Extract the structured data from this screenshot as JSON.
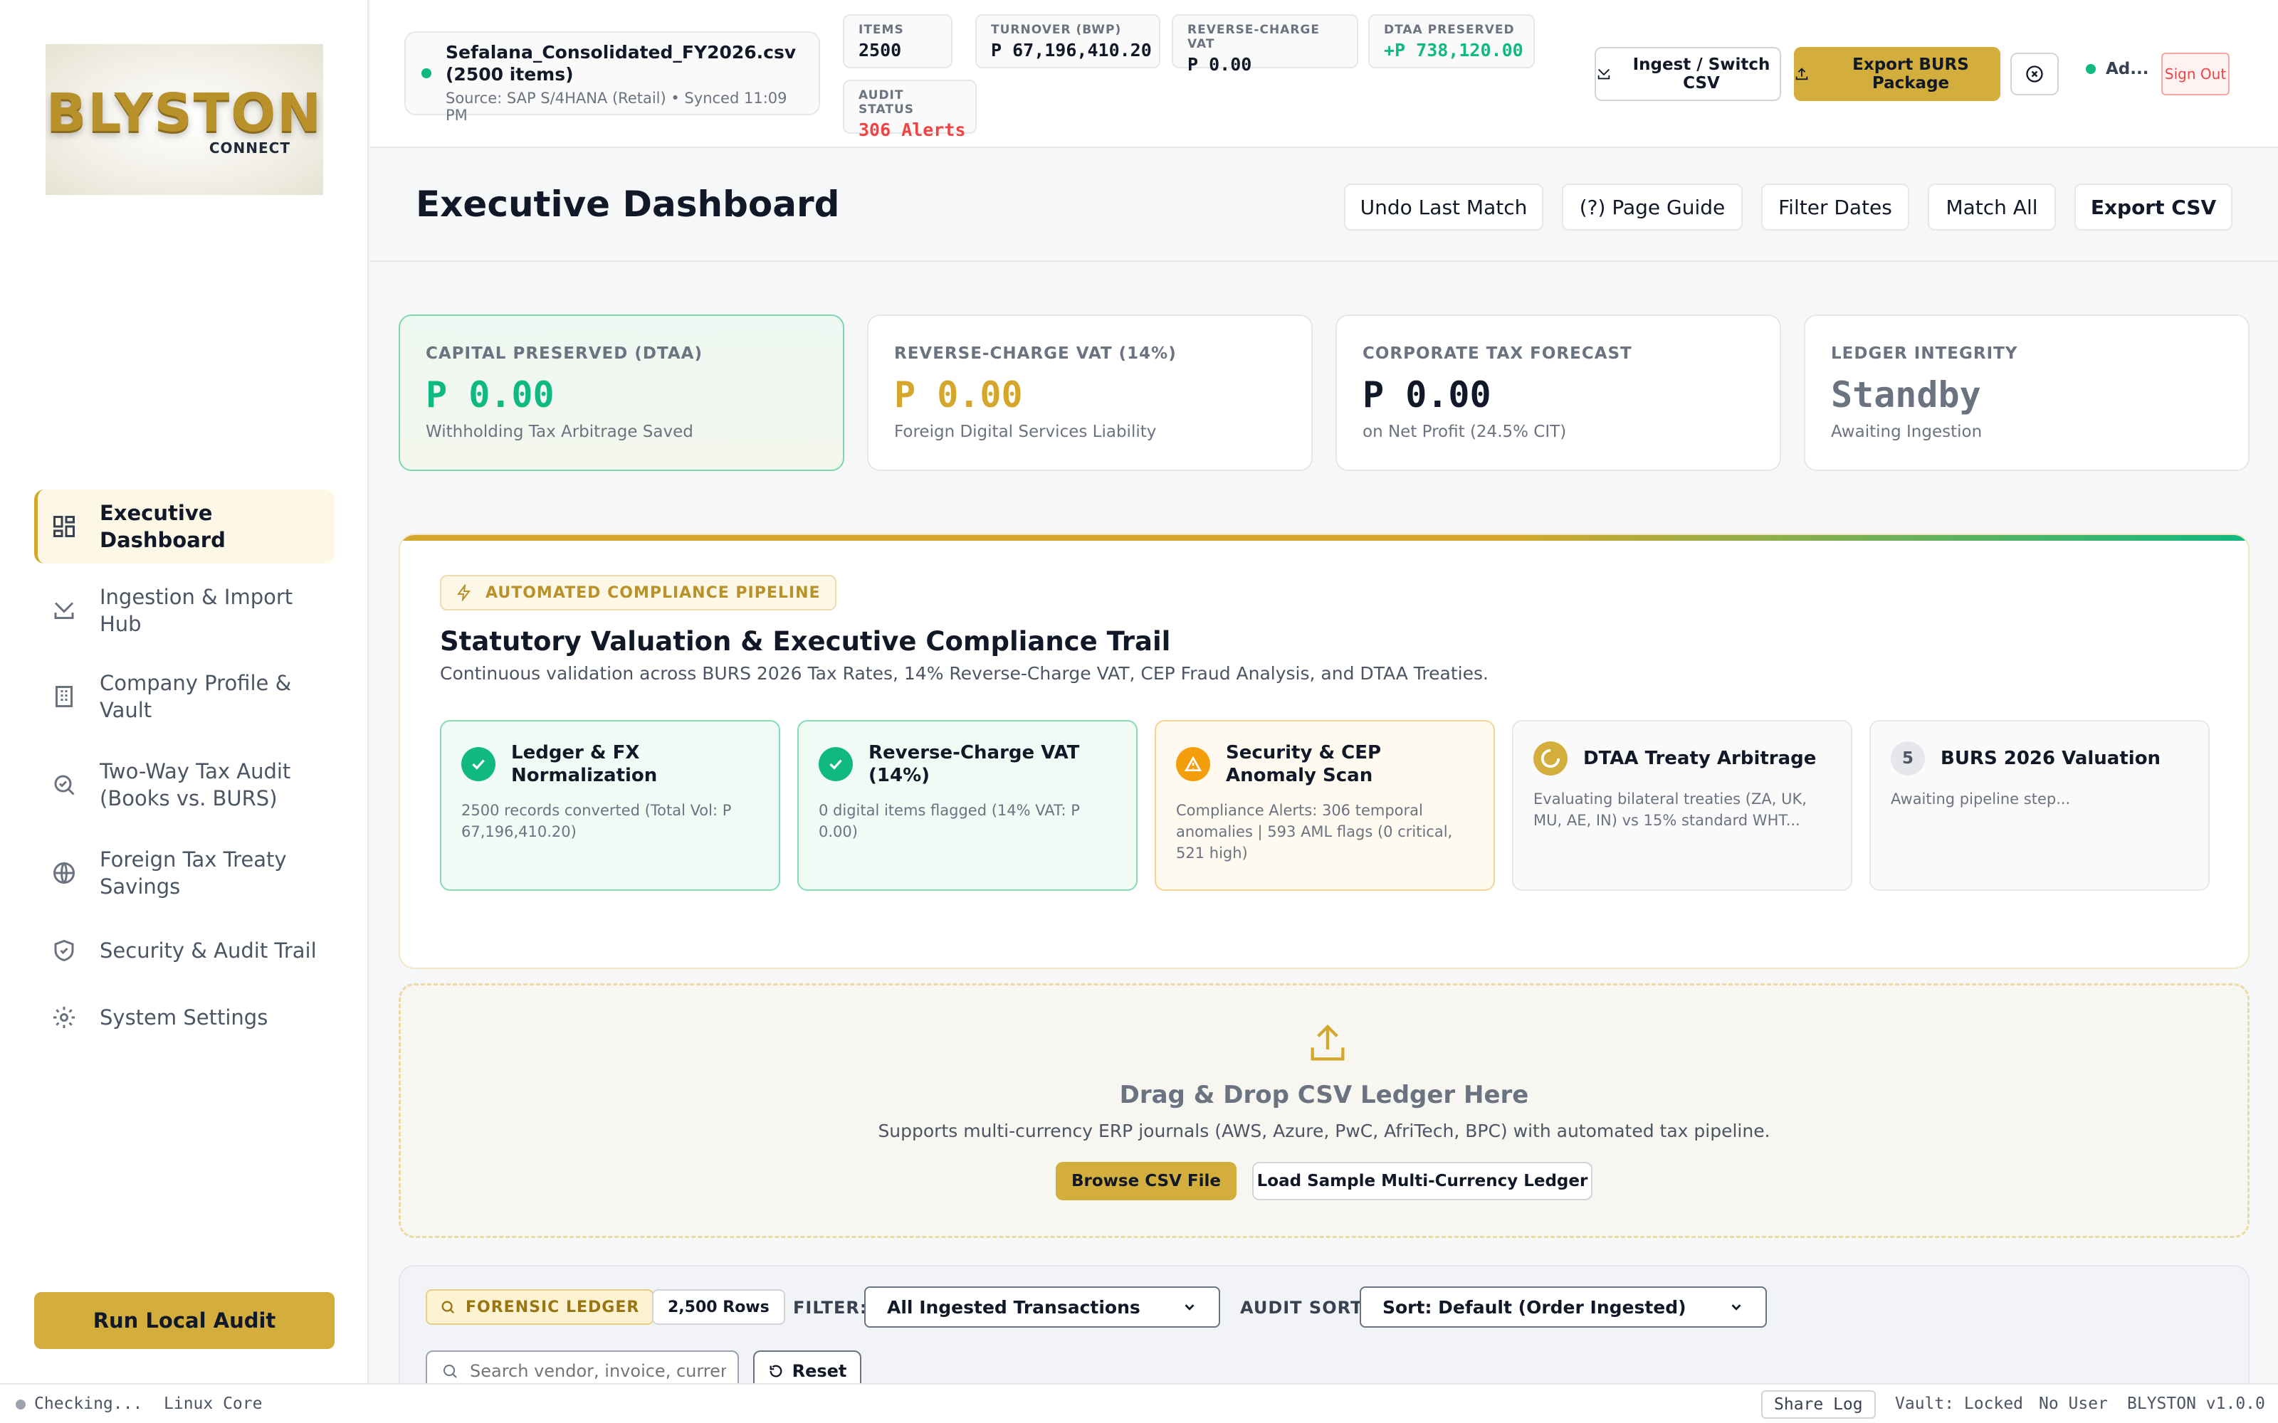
{
  "brand": {
    "logo_word": "BLYSTON",
    "logo_sub": "CONNECT"
  },
  "sidebar": {
    "items": [
      {
        "label": "Executive Dashboard",
        "icon": "dashboard-grid-icon",
        "active": true
      },
      {
        "label": "Ingestion & Import Hub",
        "icon": "tray-download-icon"
      },
      {
        "label": "Company Profile & Vault",
        "icon": "building-icon"
      },
      {
        "label": "Two-Way Tax Audit (Books vs. BURS)",
        "icon": "search-audit-icon"
      },
      {
        "label": "Foreign Tax Treaty Savings",
        "icon": "globe-icon"
      },
      {
        "label": "Security & Audit Trail",
        "icon": "shield-check-icon"
      },
      {
        "label": "System Settings",
        "icon": "gear-icon"
      }
    ],
    "run_audit_label": "Run Local Audit"
  },
  "topbar": {
    "file_name": "Sefalana_Consolidated_FY2026.csv (2500 items)",
    "file_source": "Source: SAP S/4HANA (Retail) • Synced 11:09 PM",
    "stats": {
      "items_label": "ITEMS",
      "items_value": "2500",
      "turnover_label": "TURNOVER (BWP)",
      "turnover_value": "P 67,196,410.20",
      "rcvat_label": "REVERSE-CHARGE VAT",
      "rcvat_value": "P 0.00",
      "dtaa_label": "DTAA PRESERVED",
      "dtaa_value": "+P 738,120.00",
      "audit_label": "AUDIT STATUS",
      "audit_value": "306 Alerts"
    },
    "ingest_label": "Ingest / Switch CSV",
    "export_label": "Export BURS Package",
    "admin_label": "Ad...",
    "signout_label": "Sign Out"
  },
  "page": {
    "title": "Executive Dashboard",
    "actions": {
      "undo": "Undo Last Match",
      "guide": "(?) Page Guide",
      "filter": "Filter Dates",
      "match_all": "Match All",
      "export_csv": "Export CSV"
    }
  },
  "kpis": [
    {
      "label": "CAPITAL PRESERVED (DTAA)",
      "value": "P 0.00",
      "sub": "Withholding Tax Arbitrage Saved",
      "color": "#10b981"
    },
    {
      "label": "REVERSE-CHARGE VAT (14%)",
      "value": "P 0.00",
      "sub": "Foreign Digital Services Liability",
      "color": "#d4a72c"
    },
    {
      "label": "CORPORATE TAX FORECAST",
      "value": "P 0.00",
      "sub": "on Net Profit (24.5% CIT)",
      "color": "#111827"
    },
    {
      "label": "LEDGER INTEGRITY",
      "value": "Standby",
      "sub": "Awaiting Ingestion",
      "color": "#6b7280"
    }
  ],
  "pipeline": {
    "badge": "AUTOMATED COMPLIANCE PIPELINE",
    "title": "Statutory Valuation & Executive Compliance Trail",
    "subtitle": "Continuous validation across BURS 2026 Tax Rates, 14% Reverse-Charge VAT, CEP Fraud Analysis, and DTAA Treaties.",
    "steps": [
      {
        "status": "complete",
        "title": "Ledger & FX Normalization",
        "desc": "2500 records converted (Total Vol: P 67,196,410.20)"
      },
      {
        "status": "complete",
        "title": "Reverse-Charge VAT (14%)",
        "desc": "0 digital items flagged (14% VAT: P 0.00)"
      },
      {
        "status": "warning",
        "title": "Security & CEP Anomaly Scan",
        "desc": "Compliance Alerts: 306 temporal anomalies | 593 AML flags (0 critical, 521 high)"
      },
      {
        "status": "running",
        "title": "DTAA Treaty Arbitrage",
        "desc": "Evaluating bilateral treaties (ZA, UK, MU, AE, IN) vs 15% standard WHT..."
      },
      {
        "status": "pending",
        "step_number": "5",
        "title": "BURS 2026 Valuation",
        "desc": "Awaiting pipeline step..."
      }
    ]
  },
  "dropzone": {
    "title": "Drag & Drop CSV Ledger Here",
    "subtitle": "Supports multi-currency ERP journals (AWS, Azure, PwC, AfriTech, BPC) with automated tax pipeline.",
    "browse_label": "Browse CSV File",
    "sample_label": "Load Sample Multi-Currency Ledger"
  },
  "ledger": {
    "badge": "FORENSIC LEDGER",
    "rows": "2,500 Rows",
    "filter_label": "FILTER:",
    "filter_value": "All Ingested Transactions",
    "sort_label": "AUDIT SORT:",
    "sort_value": "Sort: Default (Order Ingested)",
    "search_placeholder": "Search vendor, invoice, currency",
    "reset_label": "Reset"
  },
  "footer": {
    "status": "Checking...",
    "core": "Linux Core",
    "share": "Share Log",
    "vault": "Vault: Locked",
    "user": "No User",
    "version": "BLYSTON v1.0.0"
  },
  "colors": {
    "accent_gold": "#d4ae3c",
    "success_green": "#10b981",
    "alert_red": "#ef4444",
    "warning_amber": "#f59e0b"
  }
}
